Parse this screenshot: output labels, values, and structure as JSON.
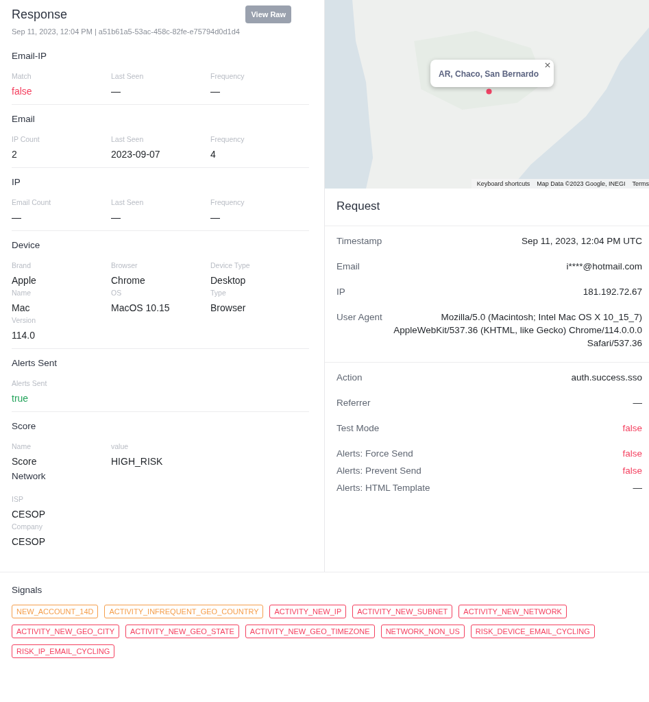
{
  "response": {
    "title": "Response",
    "subtitle": "Sep 11, 2023, 12:04 PM | a51b61a5-53ac-458c-82fe-e75794d0d1d4",
    "view_raw_button": "View Raw",
    "sections": [
      {
        "title": "Email-IP",
        "fields": [
          {
            "label": "Match",
            "value": "false",
            "color": "#f43f5e"
          },
          {
            "label": "Last Seen",
            "value": "—"
          },
          {
            "label": "Frequency",
            "value": "—"
          }
        ]
      },
      {
        "title": "Email",
        "fields": [
          {
            "label": "IP Count",
            "value": "2"
          },
          {
            "label": "Last Seen",
            "value": "2023-09-07"
          },
          {
            "label": "Frequency",
            "value": "4"
          }
        ]
      },
      {
        "title": "IP",
        "fields": [
          {
            "label": "Email Count",
            "value": "—"
          },
          {
            "label": "Last Seen",
            "value": "—"
          },
          {
            "label": "Frequency",
            "value": "—"
          }
        ]
      },
      {
        "title": "Device",
        "fields": [
          {
            "label": "Brand",
            "value": "Apple"
          },
          {
            "label": "Browser",
            "value": "Chrome"
          },
          {
            "label": "Device Type",
            "value": "Desktop"
          },
          {
            "label": "Name",
            "value": "Mac"
          },
          {
            "label": "OS",
            "value": "MacOS 10.15"
          },
          {
            "label": "Type",
            "value": "Browser"
          },
          {
            "label": "Version",
            "value": "114.0"
          }
        ]
      },
      {
        "title": "Alerts Sent",
        "fields": [
          {
            "label": "Alerts Sent",
            "value": "true",
            "color": "#22a35a"
          }
        ]
      },
      {
        "title": "Score",
        "fields": [
          {
            "label": "Name",
            "value": "Score"
          },
          {
            "label": "value",
            "value": "HIGH_RISK"
          }
        ],
        "subsection": {
          "title": "Network",
          "fields": [
            {
              "label": "ISP",
              "value": "CESOP"
            },
            {
              "label": "Company",
              "value": "CESOP"
            }
          ]
        }
      }
    ]
  },
  "map": {
    "popup": "AR, Chaco, San Bernardo",
    "attribution": [
      "Keyboard shortcuts",
      "Map Data ©2023 Google, INEGI",
      "Terms"
    ]
  },
  "request": {
    "title": "Request",
    "blocks": [
      {
        "groups": [
          {
            "kind": "spaced",
            "rows": [
              {
                "label": "Timestamp",
                "value": "Sep 11, 2023, 12:04 PM UTC"
              },
              {
                "label": "Email",
                "value": "i****@hotmail.com"
              },
              {
                "label": "IP",
                "value": "181.192.72.67"
              },
              {
                "label": "User Agent",
                "value": "Mozilla/5.0 (Macintosh; Intel Mac OS X 10_15_7) AppleWebKit/537.36 (KHTML, like Gecko) Chrome/114.0.0.0 Safari/537.36"
              }
            ]
          }
        ]
      },
      {
        "groups": [
          {
            "kind": "spaced",
            "rows": [
              {
                "label": "Action",
                "value": "auth.success.sso"
              },
              {
                "label": "Referrer",
                "value": "—"
              },
              {
                "label": "Test Mode",
                "value": "false",
                "color": "#f43f5e"
              }
            ]
          },
          {
            "kind": "compact",
            "rows": [
              {
                "label": "Alerts: Force Send",
                "value": "false",
                "color": "#f43f5e"
              },
              {
                "label": "Alerts: Prevent Send",
                "value": "false",
                "color": "#f43f5e"
              },
              {
                "label": "Alerts: HTML Template",
                "value": "—"
              }
            ]
          }
        ]
      }
    ]
  },
  "signals": {
    "title": "Signals",
    "tags": [
      {
        "label": "NEW_ACCOUNT_14D",
        "color": "#f59e4b"
      },
      {
        "label": "ACTIVITY_INFREQUENT_GEO_COUNTRY",
        "color": "#f59e4b"
      },
      {
        "label": "ACTIVITY_NEW_IP",
        "color": "#f43f5e"
      },
      {
        "label": "ACTIVITY_NEW_SUBNET",
        "color": "#f43f5e"
      },
      {
        "label": "ACTIVITY_NEW_NETWORK",
        "color": "#f43f5e"
      },
      {
        "label": "ACTIVITY_NEW_GEO_CITY",
        "color": "#f43f5e"
      },
      {
        "label": "ACTIVITY_NEW_GEO_STATE",
        "color": "#f43f5e"
      },
      {
        "label": "ACTIVITY_NEW_GEO_TIMEZONE",
        "color": "#f43f5e"
      },
      {
        "label": "NETWORK_NON_US",
        "color": "#f43f5e"
      },
      {
        "label": "RISK_DEVICE_EMAIL_CYCLING",
        "color": "#f43f5e"
      },
      {
        "label": "RISK_IP_EMAIL_CYCLING",
        "color": "#f43f5e"
      }
    ]
  }
}
